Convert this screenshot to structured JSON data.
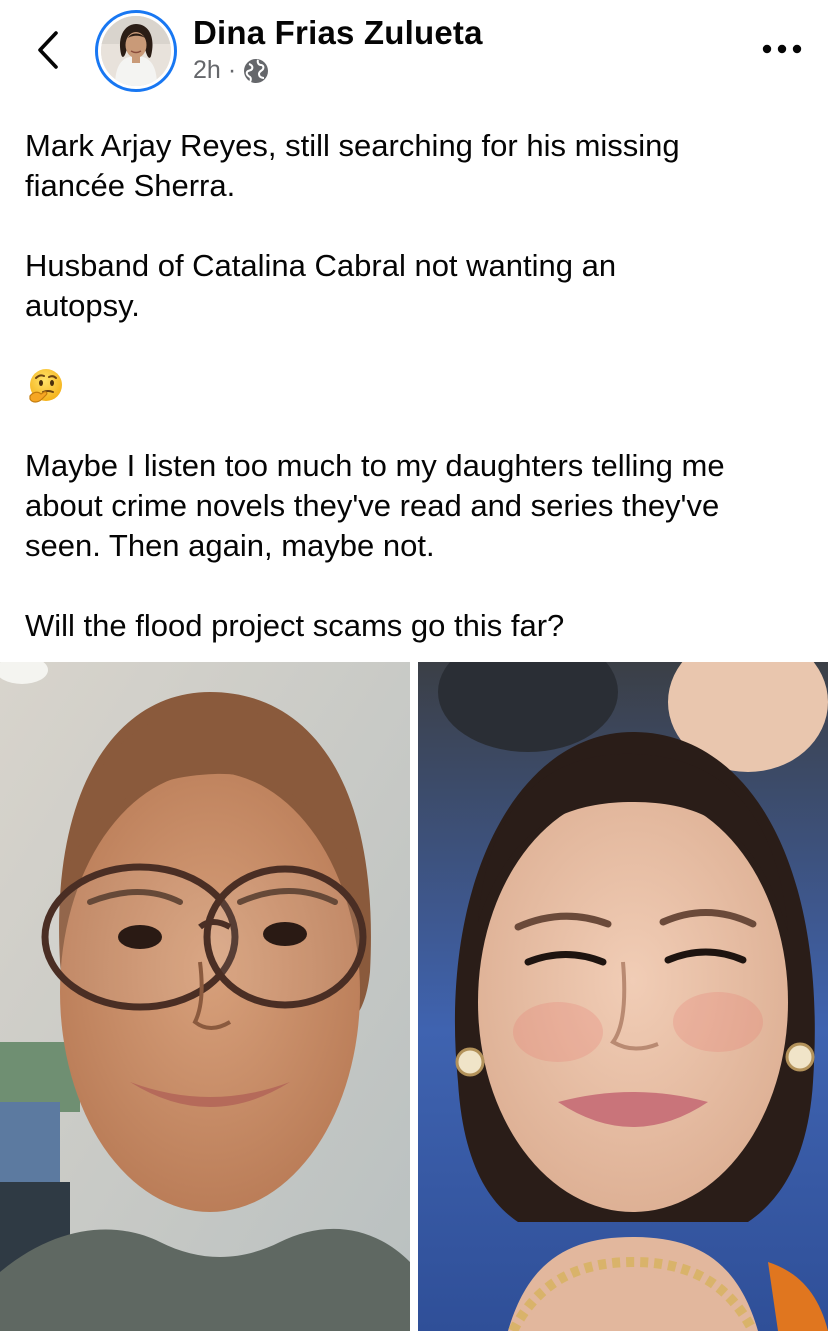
{
  "post": {
    "author_name": "Dina Frias Zulueta",
    "time": "2h",
    "separator": "·",
    "audience_icon": "globe-icon",
    "paragraphs": [
      "Mark Arjay Reyes, still searching for his missing\nfiancée Sherra.",
      "Husband of Catalina Cabral not wanting an\nautopsy.",
      "Maybe I listen too much to my daughters telling me\nabout crime novels they've read and series they've\nseen. Then again, maybe not.",
      "Will the flood project scams go this far?"
    ],
    "emoji": "thinking-face-emoji",
    "photos": [
      {
        "name": "photo-young-woman-glasses"
      },
      {
        "name": "photo-woman-earrings"
      }
    ]
  },
  "icons": {
    "back": "chevron-left-icon",
    "more": "more-options-icon"
  },
  "colors": {
    "accent": "#1877f2",
    "text": "#050505",
    "secondary_text": "#65676b"
  }
}
